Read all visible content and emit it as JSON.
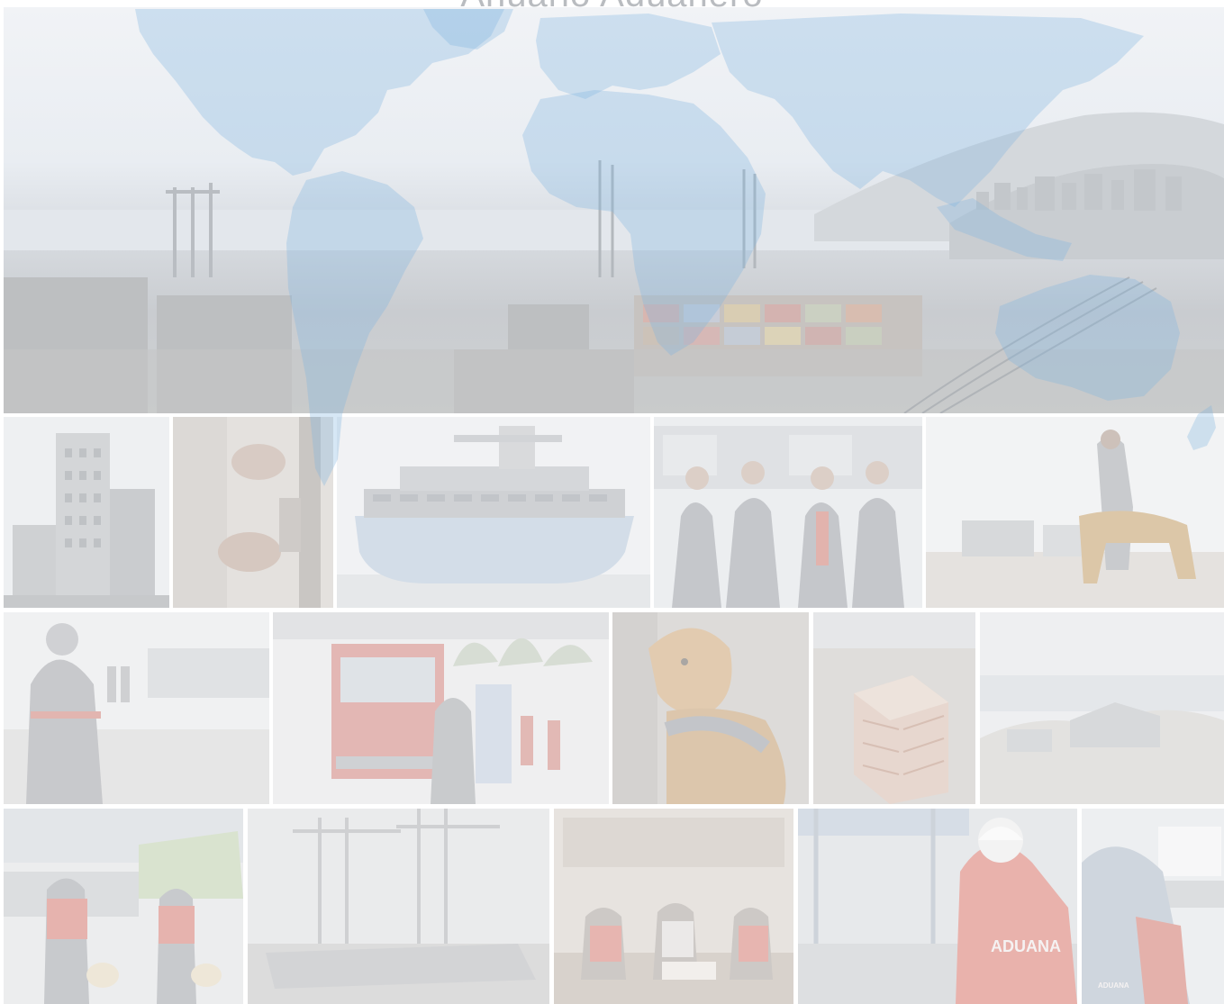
{
  "header": {
    "title": "Anuario Aduanero"
  },
  "collage": {
    "badges": {
      "aduana_large": "ADUANA",
      "aduana_small": "ADUANA"
    }
  },
  "colors": {
    "map_blue": "#7fb3e0",
    "page_background": "#ffffff",
    "vest_red": "#e58a86"
  }
}
